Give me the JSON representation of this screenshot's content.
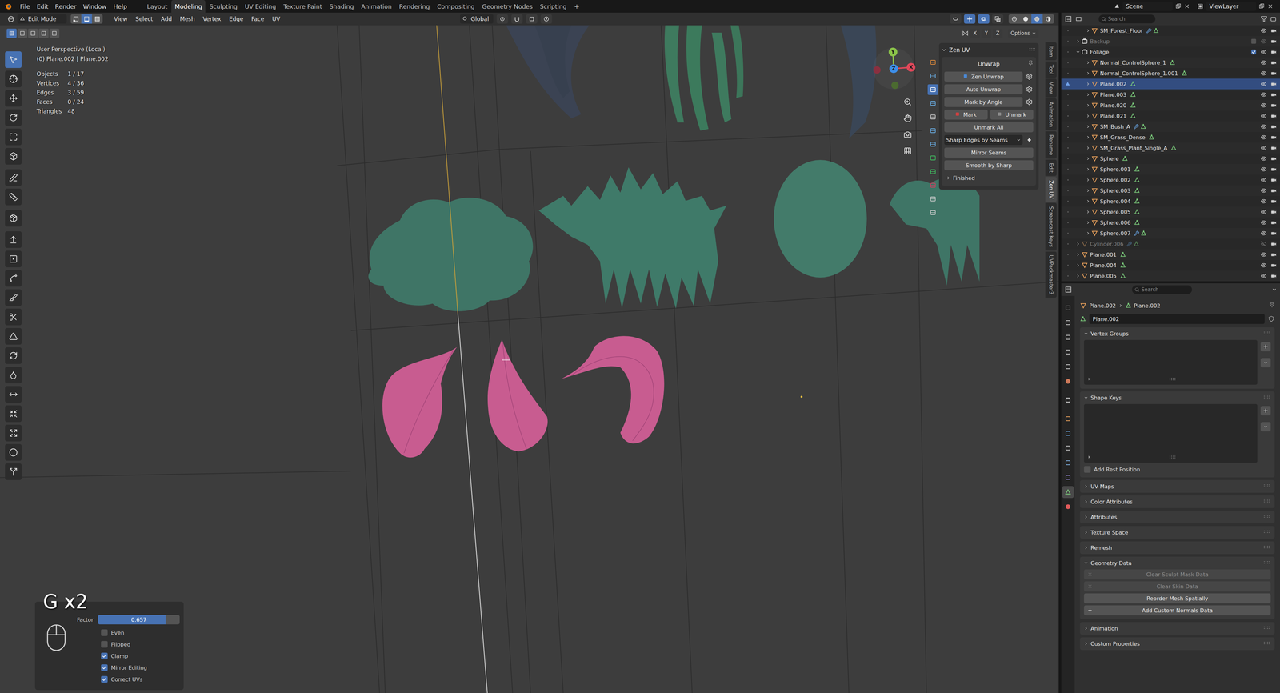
{
  "topbar": {
    "menus": [
      "File",
      "Edit",
      "Render",
      "Window",
      "Help"
    ],
    "workspaces": [
      {
        "label": "Layout",
        "selected": false
      },
      {
        "label": "Modeling",
        "selected": true
      },
      {
        "label": "Sculpting",
        "selected": false
      },
      {
        "label": "UV Editing",
        "selected": false
      },
      {
        "label": "Texture Paint",
        "selected": false
      },
      {
        "label": "Shading",
        "selected": false
      },
      {
        "label": "Animation",
        "selected": false
      },
      {
        "label": "Rendering",
        "selected": false
      },
      {
        "label": "Compositing",
        "selected": false
      },
      {
        "label": "Geometry Nodes",
        "selected": false
      },
      {
        "label": "Scripting",
        "selected": false
      }
    ],
    "add_workspace": "+",
    "scene": "Scene",
    "view_layer": "ViewLayer"
  },
  "viewport_header": {
    "mode": "Edit Mode",
    "select_modes": [
      {
        "kind": "vertex",
        "selected": false
      },
      {
        "kind": "edge",
        "selected": true
      },
      {
        "kind": "face",
        "selected": false
      }
    ],
    "menus": [
      "View",
      "Select",
      "Add",
      "Mesh",
      "Vertex",
      "Edge",
      "Face",
      "UV"
    ],
    "orientation": "Global",
    "toggles": [
      {
        "kind": "visibility",
        "on": false
      },
      {
        "kind": "gizmos",
        "on": true
      },
      {
        "kind": "overlays",
        "on": true
      },
      {
        "kind": "xray",
        "on": false
      }
    ],
    "shading_modes": [
      {
        "kind": "wireframe",
        "selected": false
      },
      {
        "kind": "solid",
        "selected": false
      },
      {
        "kind": "material",
        "selected": true
      },
      {
        "kind": "rendered",
        "selected": false
      }
    ],
    "mirror_axes": [
      "X",
      "Y",
      "Z"
    ],
    "options": "Options"
  },
  "toolbar": {
    "groups": [
      {
        "tools": [
          {
            "selected": true
          },
          {
            "selected": false
          },
          {
            "selected": false
          },
          {
            "selected": false
          },
          {
            "selected": false
          },
          {
            "selected": false
          }
        ]
      },
      {
        "tools": [
          {
            "selected": false
          },
          {
            "selected": false
          }
        ]
      },
      {
        "tools": [
          {
            "selected": false
          }
        ]
      },
      {
        "tools": [
          {
            "selected": false
          },
          {
            "selected": false
          },
          {
            "selected": false
          },
          {
            "selected": false
          },
          {
            "selected": false
          },
          {
            "selected": false
          },
          {
            "selected": false
          },
          {
            "selected": false
          },
          {
            "selected": false
          },
          {
            "selected": false
          },
          {
            "selected": false
          },
          {
            "selected": false
          },
          {
            "selected": false
          }
        ]
      }
    ]
  },
  "overlay": {
    "view": "User Perspective (Local)",
    "object": "(0) Plane.002 | Plane.002",
    "stats": [
      {
        "label": "Objects",
        "value": "1 / 17"
      },
      {
        "label": "Vertices",
        "value": "4 / 36"
      },
      {
        "label": "Edges",
        "value": "3 / 59"
      },
      {
        "label": "Faces",
        "value": "0 / 24"
      },
      {
        "label": "Triangles",
        "value": "48"
      }
    ]
  },
  "gizmo_axes": [
    "X",
    "Y",
    "Z"
  ],
  "operator_panel": {
    "keys": "G x2",
    "factor": {
      "label": "Factor",
      "value": "0.657",
      "level": 0.83
    },
    "options": [
      {
        "label": "Even",
        "checked": false
      },
      {
        "label": "Flipped",
        "checked": false
      },
      {
        "label": "Clamp",
        "checked": true
      },
      {
        "label": "Mirror Editing",
        "checked": true
      },
      {
        "label": "Correct UVs",
        "checked": true
      }
    ]
  },
  "zen_uv": {
    "title": "Zen UV",
    "section": "Unwrap",
    "icon_strip": [
      {
        "selected": false
      },
      {
        "selected": false
      },
      {
        "selected": true
      },
      {
        "selected": false
      },
      {
        "selected": false
      },
      {
        "selected": false
      },
      {
        "selected": false
      },
      {
        "selected": false
      },
      {
        "selected": false
      },
      {
        "selected": false
      },
      {
        "selected": false
      },
      {
        "selected": false
      }
    ],
    "rows": [
      {
        "kind": "button",
        "labels": [
          "Zen Unwrap"
        ],
        "settings": true
      },
      {
        "kind": "button",
        "labels": [
          "Auto Unwrap"
        ],
        "settings": true
      },
      {
        "kind": "button",
        "labels": [
          "Mark by Angle"
        ],
        "settings": true
      },
      {
        "kind": "pair",
        "labels": [
          "Mark",
          "Unmark"
        ],
        "settings": false
      },
      {
        "kind": "button",
        "labels": [
          "Unmark All"
        ],
        "settings": false
      },
      {
        "kind": "dropdown",
        "labels": [
          "Sharp Edges by Seams"
        ],
        "settings": false
      },
      {
        "kind": "button",
        "labels": [
          "Mirror Seams"
        ],
        "settings": false
      },
      {
        "kind": "button",
        "labels": [
          "Smooth by Sharp"
        ],
        "settings": false
      }
    ],
    "subpanel": {
      "label": "Finished",
      "expanded": false
    }
  },
  "side_tabs": [
    {
      "label": "Item",
      "selected": false
    },
    {
      "label": "Tool",
      "selected": false
    },
    {
      "label": "View",
      "selected": false
    },
    {
      "label": "Animation",
      "selected": false
    },
    {
      "label": "Rename",
      "selected": false
    },
    {
      "label": "Edit",
      "selected": false
    },
    {
      "label": "Zen UV",
      "selected": true
    },
    {
      "label": "Screencast Keys",
      "selected": false
    },
    {
      "label": "UVPackmaster3",
      "selected": false
    }
  ],
  "outliner": {
    "search": "Search",
    "items": [
      {
        "name": "SM_Forest_Floor",
        "kind": "object",
        "nested": true,
        "expanded": false,
        "selected": false,
        "visible": true,
        "included": true,
        "modifier": true
      },
      {
        "name": "Backup",
        "kind": "collection",
        "nested": false,
        "expanded": false,
        "selected": false,
        "visible": true,
        "included": false,
        "modifier": false
      },
      {
        "name": "Foliage",
        "kind": "collection",
        "nested": false,
        "expanded": true,
        "selected": false,
        "visible": true,
        "included": true,
        "modifier": false
      },
      {
        "name": "Normal_ControlSphere_1",
        "kind": "object",
        "nested": true,
        "expanded": false,
        "selected": false,
        "visible": true,
        "included": true,
        "modifier": false
      },
      {
        "name": "Normal_ControlSphere_1.001",
        "kind": "object",
        "nested": true,
        "expanded": false,
        "selected": false,
        "visible": true,
        "included": true,
        "modifier": false
      },
      {
        "name": "Plane.002",
        "kind": "object",
        "nested": true,
        "expanded": false,
        "selected": true,
        "visible": true,
        "included": true,
        "modifier": false
      },
      {
        "name": "Plane.003",
        "kind": "object",
        "nested": true,
        "expanded": false,
        "selected": false,
        "visible": true,
        "included": true,
        "modifier": false
      },
      {
        "name": "Plane.020",
        "kind": "object",
        "nested": true,
        "expanded": false,
        "selected": false,
        "visible": true,
        "included": true,
        "modifier": false
      },
      {
        "name": "Plane.021",
        "kind": "object",
        "nested": true,
        "expanded": false,
        "selected": false,
        "visible": true,
        "included": true,
        "modifier": false
      },
      {
        "name": "SM_Bush_A",
        "kind": "object",
        "nested": true,
        "expanded": false,
        "selected": false,
        "visible": true,
        "included": true,
        "modifier": true
      },
      {
        "name": "SM_Grass_Dense",
        "kind": "object",
        "nested": true,
        "expanded": false,
        "selected": false,
        "visible": true,
        "included": true,
        "modifier": false
      },
      {
        "name": "SM_Grass_Plant_Single_A",
        "kind": "object",
        "nested": true,
        "expanded": false,
        "selected": false,
        "visible": true,
        "included": true,
        "modifier": false
      },
      {
        "name": "Sphere",
        "kind": "object",
        "nested": true,
        "expanded": false,
        "selected": false,
        "visible": true,
        "included": true,
        "modifier": false
      },
      {
        "name": "Sphere.001",
        "kind": "object",
        "nested": true,
        "expanded": false,
        "selected": false,
        "visible": true,
        "included": true,
        "modifier": false
      },
      {
        "name": "Sphere.002",
        "kind": "object",
        "nested": true,
        "expanded": false,
        "selected": false,
        "visible": true,
        "included": true,
        "modifier": false
      },
      {
        "name": "Sphere.003",
        "kind": "object",
        "nested": true,
        "expanded": false,
        "selected": false,
        "visible": true,
        "included": true,
        "modifier": false
      },
      {
        "name": "Sphere.004",
        "kind": "object",
        "nested": true,
        "expanded": false,
        "selected": false,
        "visible": true,
        "included": true,
        "modifier": false
      },
      {
        "name": "Sphere.005",
        "kind": "object",
        "nested": true,
        "expanded": false,
        "selected": false,
        "visible": true,
        "included": true,
        "modifier": false
      },
      {
        "name": "Sphere.006",
        "kind": "object",
        "nested": true,
        "expanded": false,
        "selected": false,
        "visible": true,
        "included": true,
        "modifier": false
      },
      {
        "name": "Sphere.007",
        "kind": "object",
        "nested": true,
        "expanded": false,
        "selected": false,
        "visible": true,
        "included": true,
        "modifier": true
      },
      {
        "name": "Cylinder.006",
        "kind": "object",
        "nested": false,
        "expanded": false,
        "selected": false,
        "visible": false,
        "included": true,
        "modifier": true
      },
      {
        "name": "Plane.001",
        "kind": "object",
        "nested": false,
        "expanded": false,
        "selected": false,
        "visible": true,
        "included": true,
        "modifier": false
      },
      {
        "name": "Plane.004",
        "kind": "object",
        "nested": false,
        "expanded": false,
        "selected": false,
        "visible": true,
        "included": true,
        "modifier": false
      },
      {
        "name": "Plane.005",
        "kind": "object",
        "nested": false,
        "expanded": false,
        "selected": false,
        "visible": true,
        "included": true,
        "modifier": false
      }
    ]
  },
  "properties": {
    "search": "Search",
    "tabs": [
      {
        "selected": false
      },
      {
        "selected": false
      },
      {
        "selected": false
      },
      {
        "selected": false
      },
      {
        "selected": false
      },
      {
        "selected": false
      },
      {
        "selected": false
      },
      {
        "selected": false
      },
      {
        "selected": false
      },
      {
        "selected": false
      },
      {
        "selected": false
      },
      {
        "selected": false
      },
      {
        "selected": true
      },
      {
        "selected": false
      }
    ],
    "breadcrumb": [
      "Plane.002",
      "Plane.002"
    ],
    "name": "Plane.002",
    "panels": [
      {
        "title": "Vertex Groups",
        "expanded": true,
        "kind": "list",
        "option": null,
        "buttons": []
      },
      {
        "title": "Shape Keys",
        "expanded": true,
        "kind": "list",
        "option": {
          "label": "Add Rest Position",
          "checked": false
        },
        "buttons": []
      },
      {
        "title": "UV Maps",
        "expanded": false,
        "kind": "plain",
        "option": null,
        "buttons": []
      },
      {
        "title": "Color Attributes",
        "expanded": false,
        "kind": "plain",
        "option": null,
        "buttons": []
      },
      {
        "title": "Attributes",
        "expanded": false,
        "kind": "plain",
        "option": null,
        "buttons": []
      },
      {
        "title": "Texture Space",
        "expanded": false,
        "kind": "plain",
        "option": null,
        "buttons": []
      },
      {
        "title": "Remesh",
        "expanded": false,
        "kind": "plain",
        "option": null,
        "buttons": []
      },
      {
        "title": "Geometry Data",
        "expanded": true,
        "kind": "buttons",
        "option": null,
        "buttons": [
          {
            "label": "Clear Sculpt Mask Data",
            "disabled": true,
            "kind": "clear"
          },
          {
            "label": "Clear Skin Data",
            "disabled": true,
            "kind": "clear"
          },
          {
            "label": "Reorder Mesh Spatially",
            "disabled": false,
            "kind": "plain"
          },
          {
            "label": "Add Custom Normals Data",
            "disabled": false,
            "kind": "add"
          }
        ]
      },
      {
        "title": "Animation",
        "expanded": false,
        "kind": "plain",
        "option": null,
        "buttons": []
      },
      {
        "title": "Custom Properties",
        "expanded": false,
        "kind": "plain",
        "option": null,
        "buttons": []
      }
    ]
  }
}
